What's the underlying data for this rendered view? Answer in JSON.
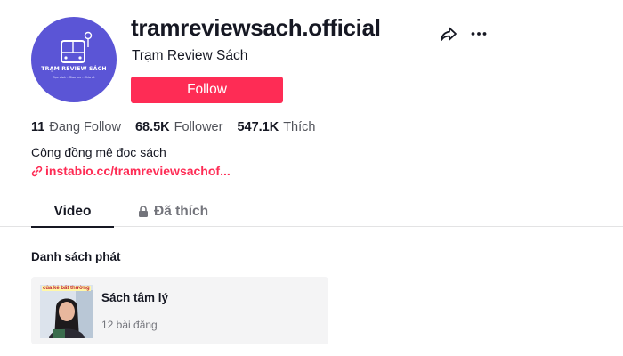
{
  "profile": {
    "username": "tramreviewsach.official",
    "nickname": "Trạm Review Sách",
    "avatar": {
      "brand_text": "TRẠM REVIEW SÁCH",
      "tagline": "Đọc sách - Giao lưu - Chia sẻ",
      "background_color": "#5b55d6",
      "icon": "bus-book-icon"
    },
    "follow_label": "Follow",
    "bio": "Cộng đồng mê đọc sách",
    "link": "instabio.cc/tramreviewsachof..."
  },
  "stats": [
    {
      "value": "11",
      "label": "Đang Follow"
    },
    {
      "value": "68.5K",
      "label": "Follower"
    },
    {
      "value": "547.1K",
      "label": "Thích"
    }
  ],
  "tabs": [
    {
      "label": "Video",
      "active": true
    },
    {
      "label": "Đã thích",
      "active": false,
      "icon": "lock-icon"
    }
  ],
  "playlists": {
    "section_title": "Danh sách phát",
    "items": [
      {
        "title": "Sách tâm lý",
        "count": "12 bài đăng",
        "thumb_text": "của kẻ bất thường"
      }
    ]
  },
  "colors": {
    "accent": "#fe2c55",
    "text_primary": "#161823",
    "text_secondary": "#73747b"
  },
  "icons": {
    "share": "share-icon",
    "more": "more-options-icon",
    "link": "link-icon"
  }
}
